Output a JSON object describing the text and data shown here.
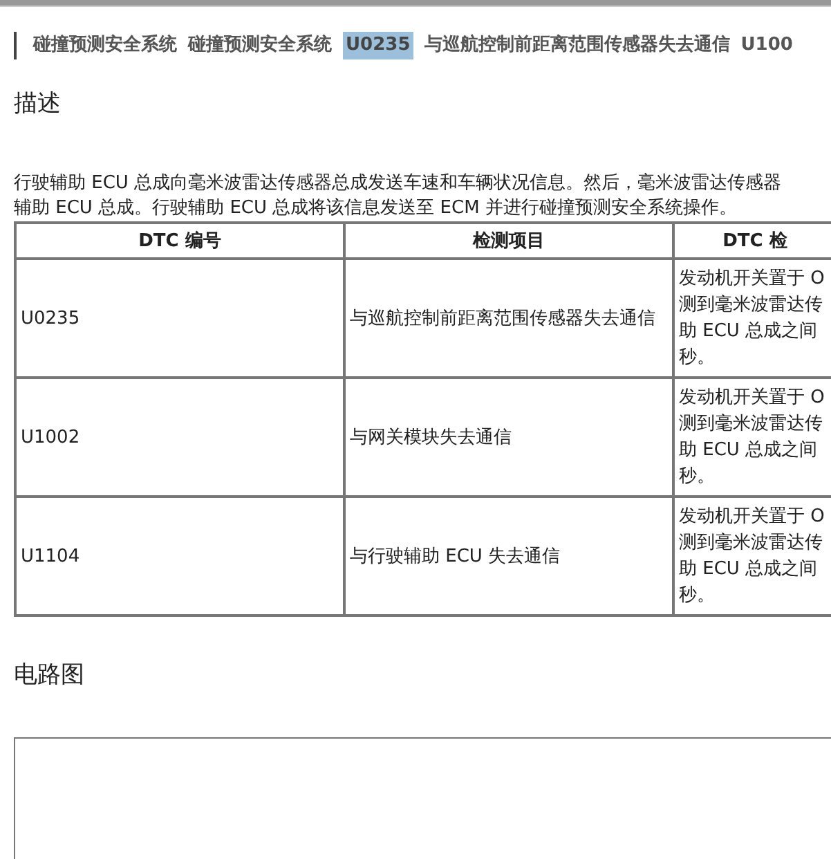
{
  "breadcrumb": [
    {
      "label": "碰撞预测安全系统",
      "selected": false
    },
    {
      "label": "碰撞预测安全系统",
      "selected": false
    },
    {
      "label": "U0235",
      "selected": true
    },
    {
      "label": "与巡航控制前距离范围传感器失去通信",
      "selected": false
    },
    {
      "label": "U100",
      "selected": false
    }
  ],
  "description": {
    "heading": "描述",
    "lines": [
      "行驶辅助 ECU 总成向毫米波雷达传感器总成发送车速和车辆状况信息。然后，毫米波雷达传感器",
      "辅助 ECU 总成。行驶辅助 ECU 总成将该信息发送至 ECM 并进行碰撞预测安全系统操作。"
    ]
  },
  "table": {
    "columns": [
      "DTC 编号",
      "检测项目",
      "DTC 检"
    ],
    "rows": [
      {
        "code": "U0235",
        "item": "与巡航控制前距离范围传感器失去通信",
        "condition": [
          "发动机开关置于 O",
          "测到毫米波雷达传",
          "助 ECU 总成之间",
          "秒。"
        ]
      },
      {
        "code": "U1002",
        "item": "与网关模块失去通信",
        "condition": [
          "发动机开关置于 O",
          "测到毫米波雷达传",
          "助 ECU 总成之间",
          "秒。"
        ]
      },
      {
        "code": "U1104",
        "item": "与行驶辅助 ECU 失去通信",
        "condition": [
          "发动机开关置于 O",
          "测到毫米波雷达传",
          "助 ECU 总成之间",
          "秒。"
        ]
      }
    ]
  },
  "circuit": {
    "heading": "电路图"
  }
}
